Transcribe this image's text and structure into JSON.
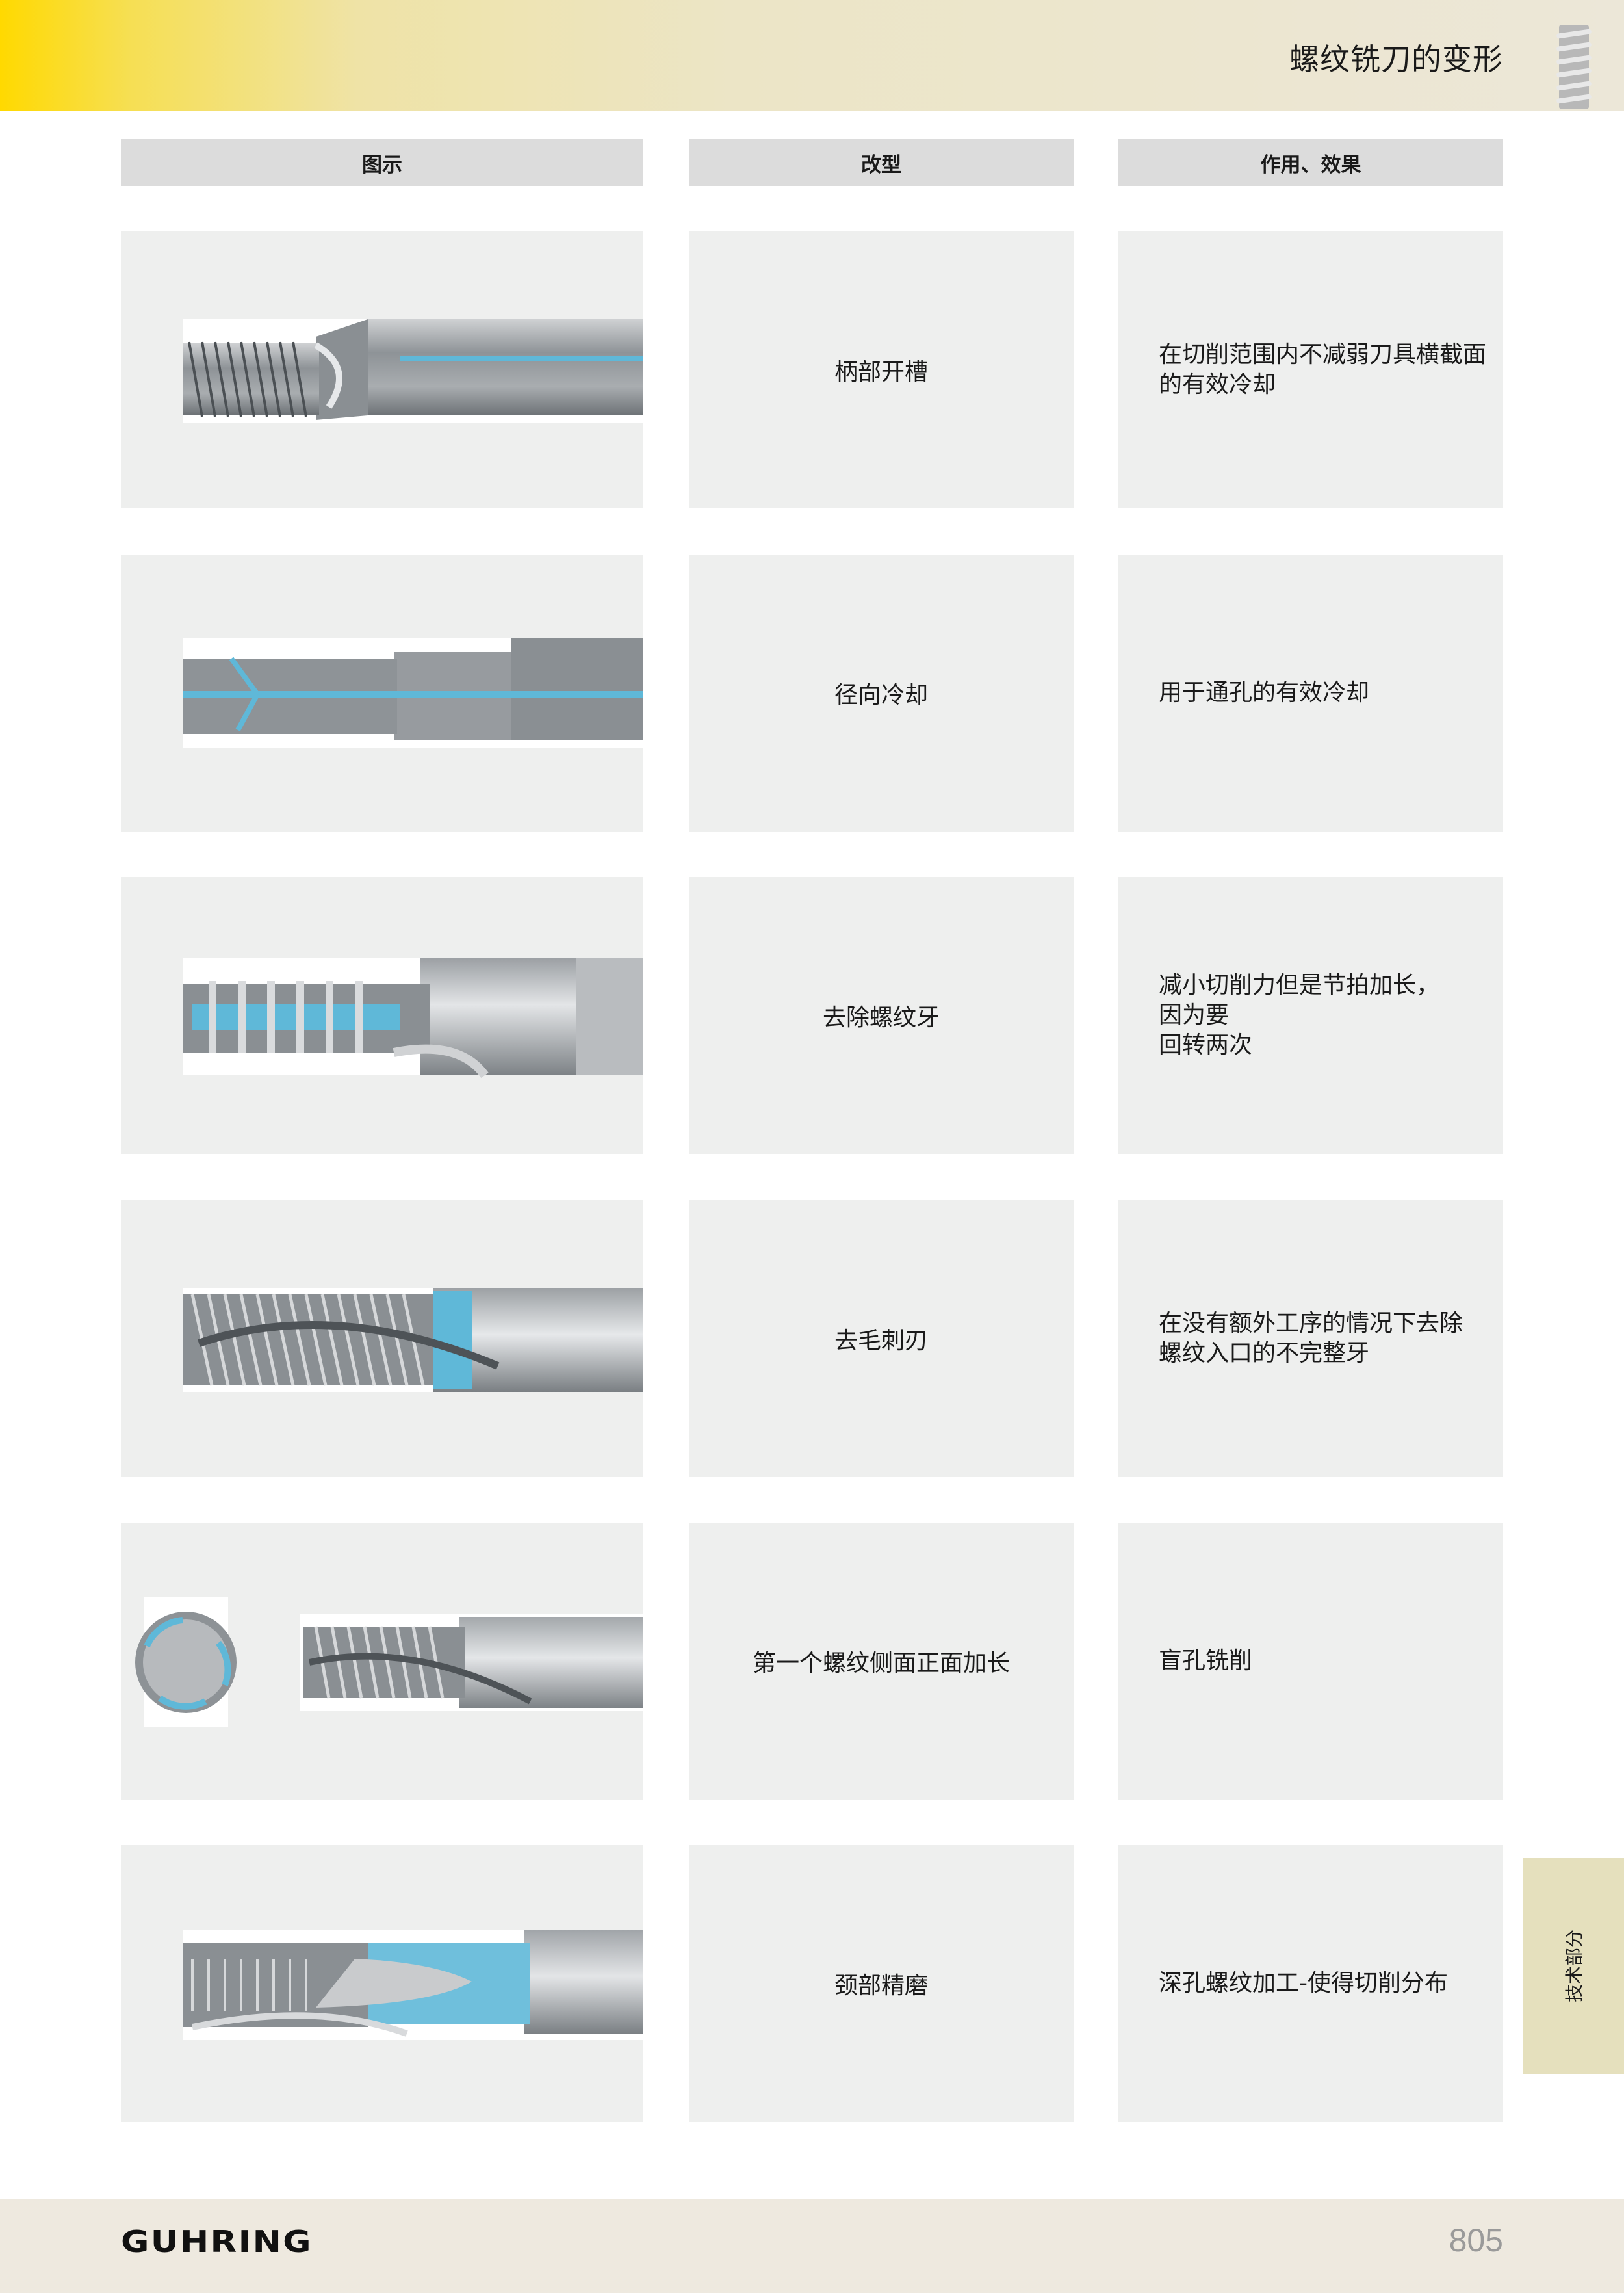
{
  "header": {
    "title": "螺纹铣刀的变形",
    "icon": "thread-tool-icon"
  },
  "columns": {
    "image": "图示",
    "modification": "改型",
    "effect": "作用、效果"
  },
  "rows": [
    {
      "image_icon": "tool-shank-slot-image",
      "modification": "柄部开槽",
      "effect": "在切削范围内不减弱刀具横截面\n的有效冷却"
    },
    {
      "image_icon": "tool-radial-coolant-image",
      "modification": "径向冷却",
      "effect": "用于通孔的有效冷却"
    },
    {
      "image_icon": "tool-thread-removed-image",
      "modification": "去除螺纹牙",
      "effect": "减小切削力但是节拍加长，\n因为要\n回转两次"
    },
    {
      "image_icon": "tool-deburr-image",
      "modification": "去毛刺刃",
      "effect": "在没有额外工序的情况下去除\n螺纹入口的不完整牙"
    },
    {
      "image_icon": "tool-front-flank-image",
      "modification": "第一个螺纹侧面正面加长",
      "effect": "盲孔铣削"
    },
    {
      "image_icon": "tool-neck-ground-image",
      "modification": "颈部精磨",
      "effect": "深孔螺纹加工-使得切削分布"
    }
  ],
  "side_tab": {
    "label": "技术部分"
  },
  "footer": {
    "logo": "GUHRING",
    "page_number": "805"
  },
  "colors": {
    "header_yellow": "#ffd900",
    "header_beige": "#ece7d8",
    "cell_gray": "#eeefee",
    "column_head_gray": "#dcdcdc",
    "coolant_blue": "#5fb8d8",
    "side_tab": "#e5e0bd",
    "footer": "#eee9df"
  }
}
